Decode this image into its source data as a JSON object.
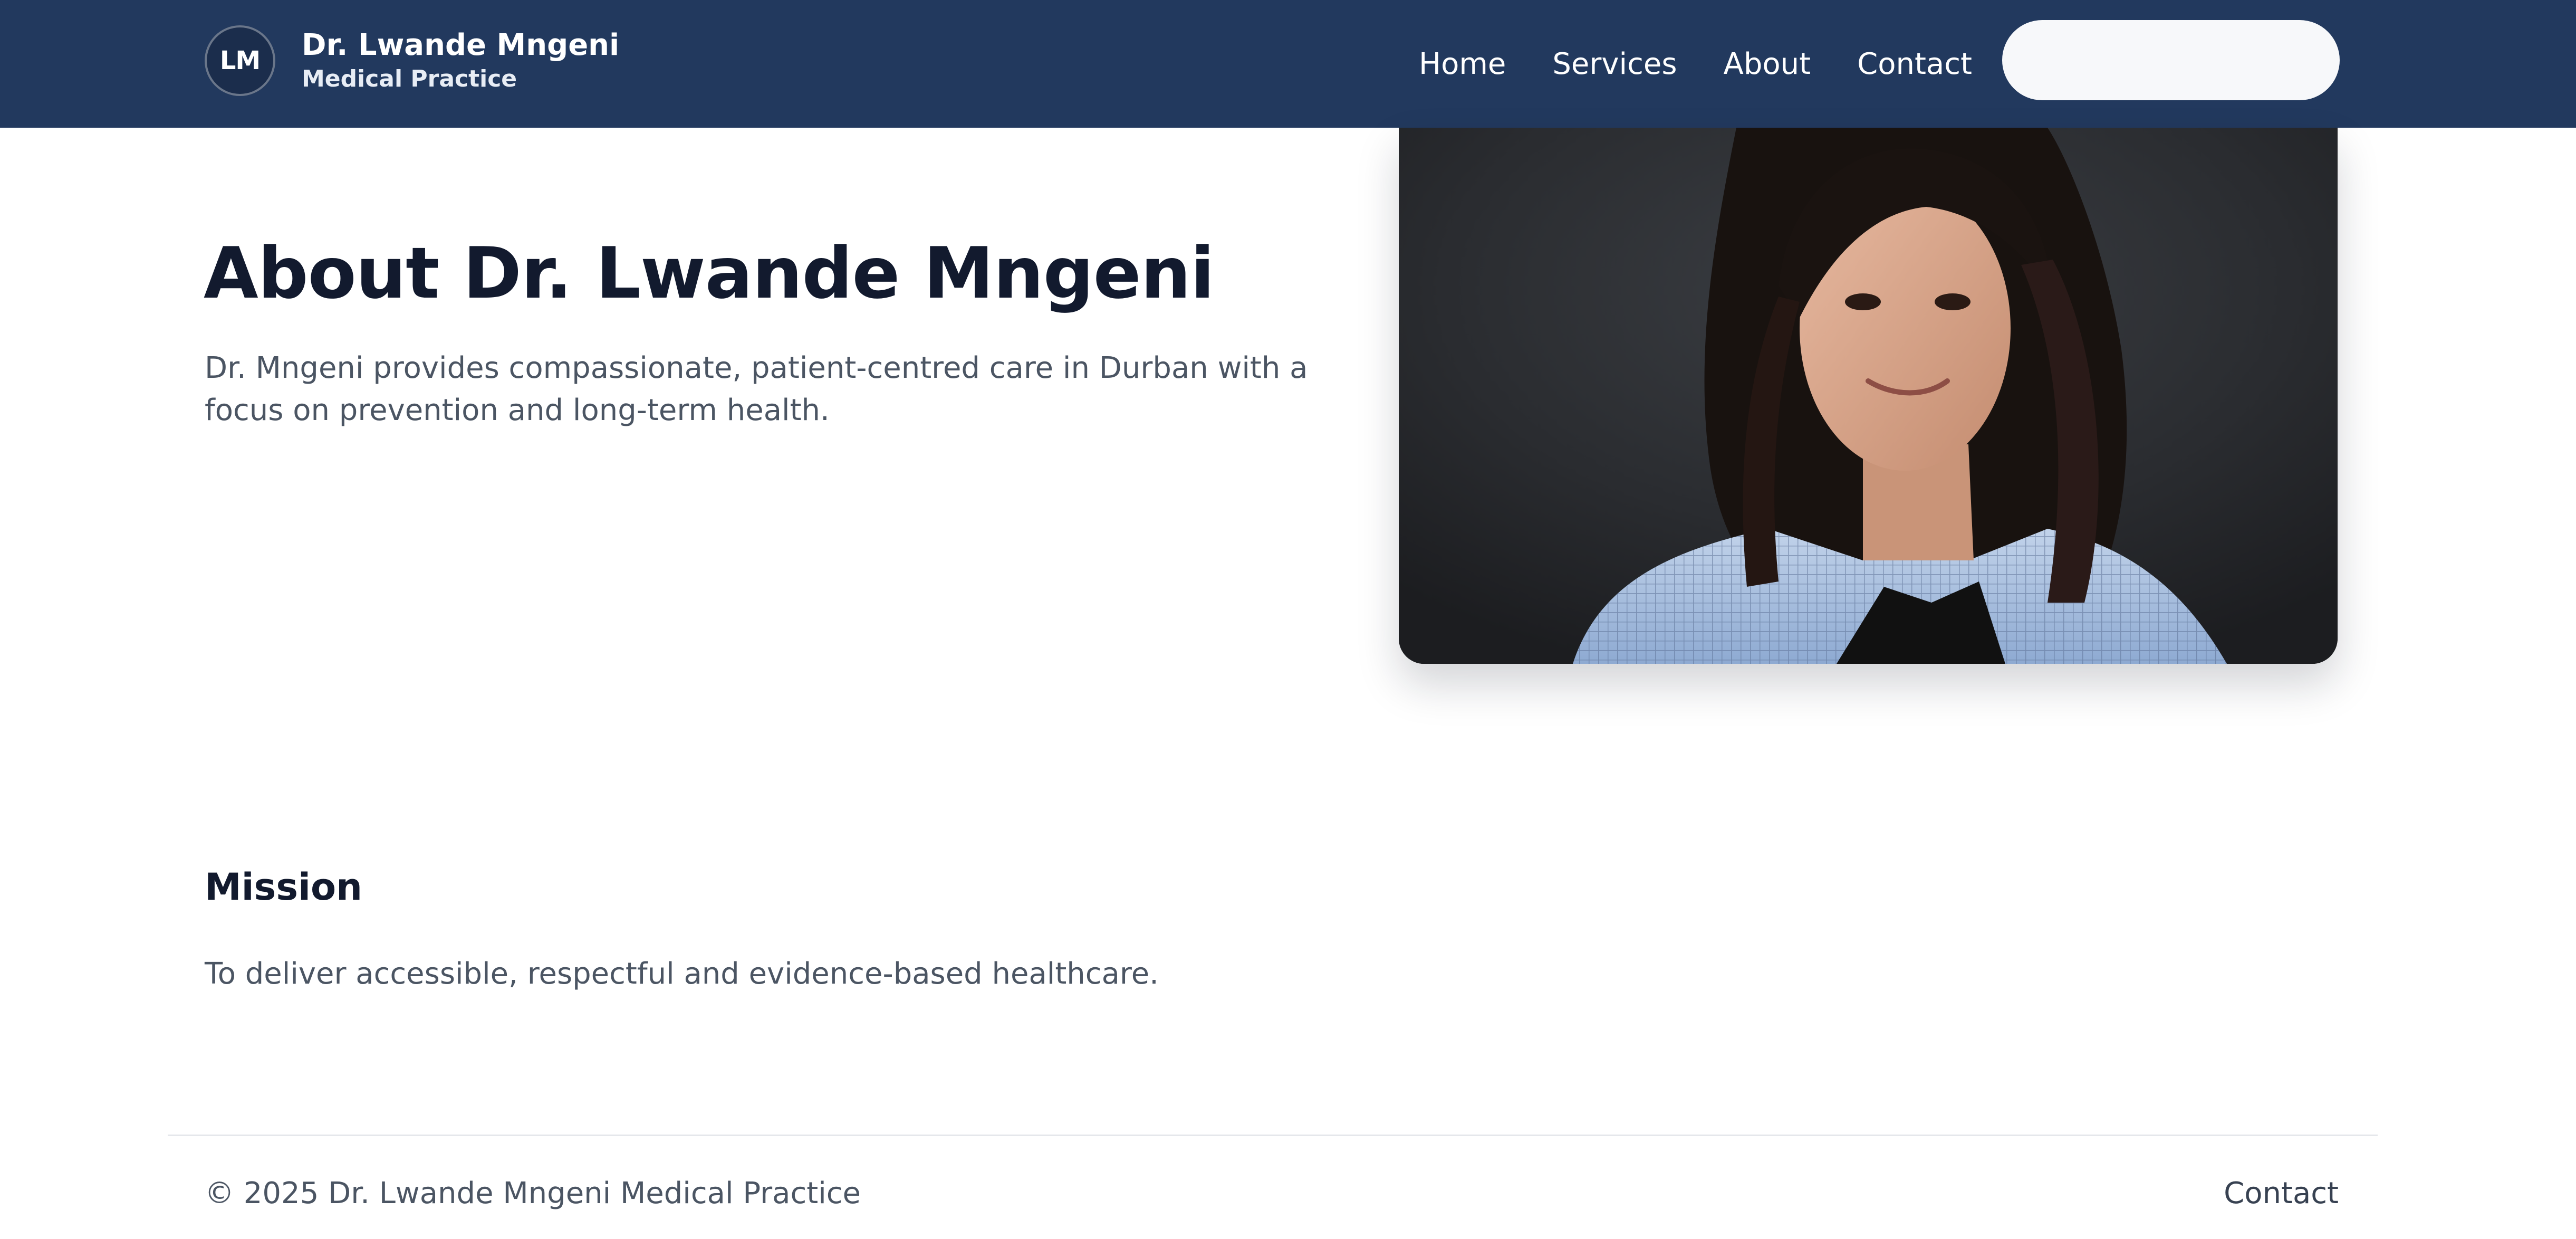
{
  "header": {
    "logo_initials": "LM",
    "brand_name": "Dr. Lwande Mngeni",
    "brand_subtitle": "Medical Practice",
    "nav": [
      "Home",
      "Services",
      "About",
      "Contact"
    ]
  },
  "hero": {
    "title": "About Dr. Lwande Mngeni",
    "description": "Dr. Mngeni provides compassionate, patient-centred care in Durban with a focus on prevention and long-term health."
  },
  "mission": {
    "title": "Mission",
    "text": "To deliver accessible, respectful and evidence-based healthcare."
  },
  "footer": {
    "copyright": "© 2025 Dr. Lwande Mngeni Medical Practice",
    "contact_link": "Contact"
  },
  "colors": {
    "header_bg": "#22395e",
    "heading": "#121a2e",
    "body_text": "#4b5563"
  }
}
